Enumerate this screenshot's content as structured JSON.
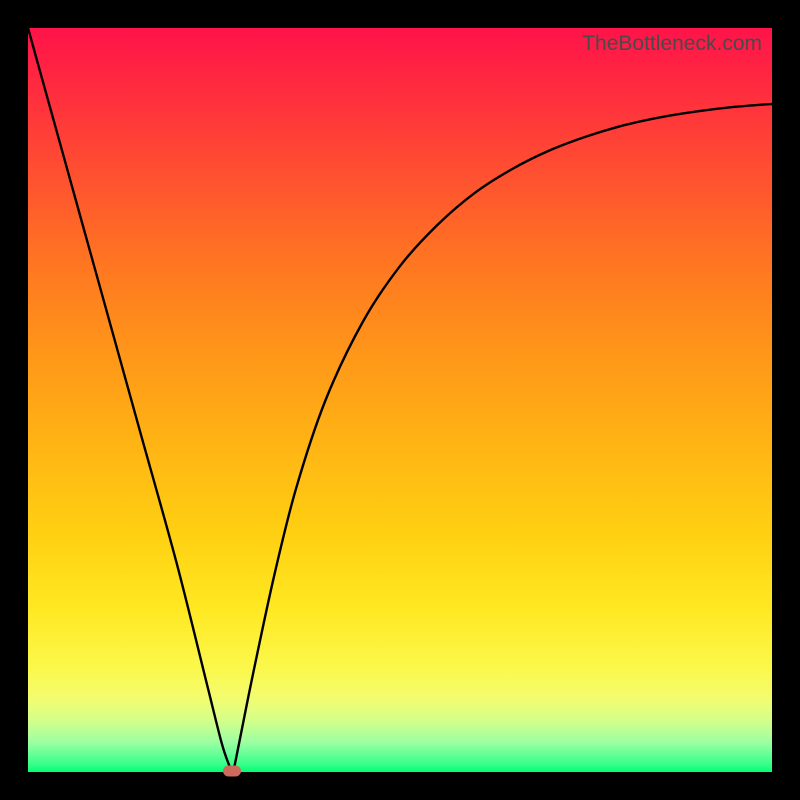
{
  "attribution": "TheBottleneck.com",
  "chart_data": {
    "type": "line",
    "title": "",
    "xlabel": "",
    "ylabel": "",
    "xlim": [
      0,
      100
    ],
    "ylim": [
      0,
      100
    ],
    "series": [
      {
        "name": "curve",
        "x": [
          0,
          5,
          10,
          15,
          20,
          24,
          26,
          27,
          27.5,
          28,
          30,
          33,
          36,
          40,
          45,
          50,
          55,
          60,
          65,
          70,
          75,
          80,
          85,
          90,
          95,
          100
        ],
        "y": [
          100,
          82,
          64,
          46,
          28,
          12,
          4,
          1,
          0,
          2,
          12,
          26,
          38,
          50,
          60.5,
          68,
          73.5,
          77.8,
          81,
          83.5,
          85.4,
          86.9,
          88,
          88.8,
          89.4,
          89.8
        ]
      }
    ],
    "marker": {
      "x": 27.4,
      "y": 0.2
    },
    "gradient_stops": [
      {
        "pos": 0.0,
        "color": "#ff134a"
      },
      {
        "pos": 0.5,
        "color": "#ffa515"
      },
      {
        "pos": 0.86,
        "color": "#fbf84b"
      },
      {
        "pos": 1.0,
        "color": "#00ff72"
      }
    ]
  }
}
